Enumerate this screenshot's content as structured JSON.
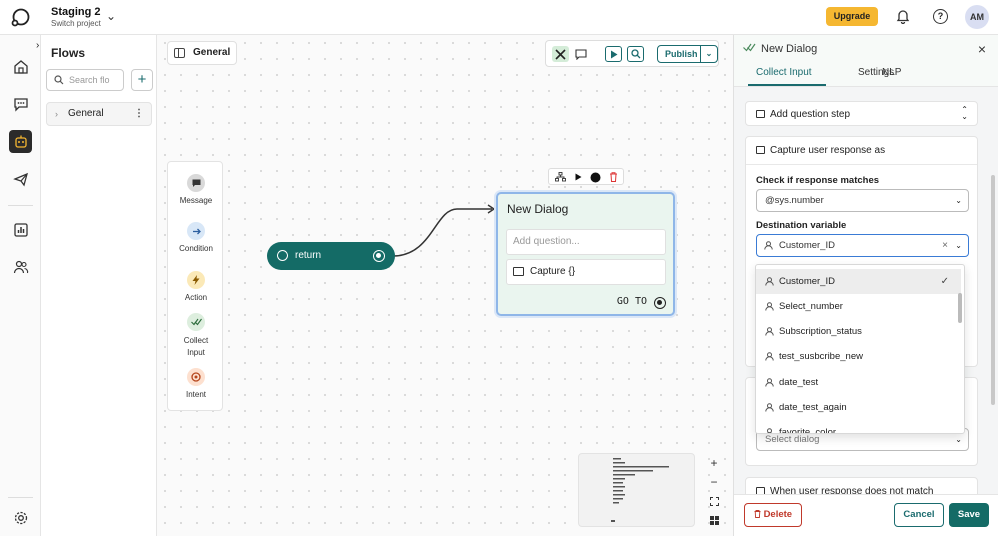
{
  "header": {
    "project_name": "Staging 2",
    "project_subtitle": "Switch project",
    "upgrade_label": "Upgrade",
    "help_glyph": "?",
    "avatar_initials": "AM"
  },
  "rail": {
    "items": [
      "home-icon",
      "chat-icon",
      "bot-icon",
      "campaign-icon",
      "analytics-icon",
      "users-icon"
    ],
    "settings": "settings-icon"
  },
  "flows": {
    "collapse_glyph": "›",
    "title": "Flows",
    "search_placeholder": "Search flo",
    "add_glyph": "+",
    "items": [
      {
        "label": "General"
      }
    ]
  },
  "canvas": {
    "breadcrumb": "General",
    "publish_label": "Publish",
    "palette": [
      {
        "label": "Message",
        "color": "#d9d9d9"
      },
      {
        "label": "Condition",
        "color": "#d8e7f7"
      },
      {
        "label": "Action",
        "color": "#fbe9b7"
      },
      {
        "label": "Collect Input",
        "color": "#ddeede"
      },
      {
        "label": "Intent",
        "color": "#fde0cf"
      }
    ],
    "return_node": {
      "label": "return"
    },
    "dialog_node": {
      "title": "New Dialog",
      "input_placeholder": "Add question...",
      "capture_label": "Capture {}",
      "goto_label": "GO TO"
    },
    "zoom_in": "+",
    "zoom_out": "−"
  },
  "panel": {
    "title": "New Dialog",
    "tabs": [
      {
        "label": "Collect Input",
        "active": true
      },
      {
        "label": "Settings",
        "active": false
      },
      {
        "label": "NLP",
        "active": false
      }
    ],
    "add_question_step": "Add question step",
    "capture_as": "Capture user response as",
    "check_label": "Check if response matches",
    "check_value": "@sys.number",
    "destination_label": "Destination variable",
    "destination_value": "Customer_ID",
    "select_dialog_placeholder": "Select dialog",
    "no_match_label": "When user response does not match",
    "dropdown_options": [
      {
        "label": "Customer_ID",
        "selected": true
      },
      {
        "label": "Select_number",
        "selected": false
      },
      {
        "label": "Subscription_status",
        "selected": false
      },
      {
        "label": "test_susbcribe_new",
        "selected": false
      },
      {
        "label": "date_test",
        "selected": false
      },
      {
        "label": "date_test_again",
        "selected": false
      },
      {
        "label": "favorite_color",
        "selected": false
      }
    ],
    "delete_label": "Delete",
    "cancel_label": "Cancel",
    "save_label": "Save"
  },
  "colors": {
    "brand": "#146b66",
    "upgrade": "#f5b731",
    "danger": "#c0392b"
  }
}
